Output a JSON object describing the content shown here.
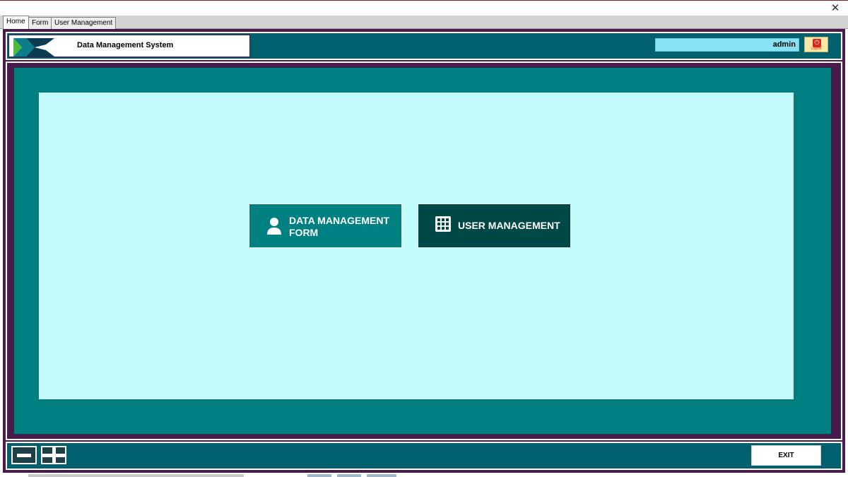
{
  "window": {
    "close_glyph": "✕"
  },
  "tabs": [
    {
      "label": "Home",
      "active": true
    },
    {
      "label": "Form",
      "active": false
    },
    {
      "label": "User Management",
      "active": false
    }
  ],
  "header": {
    "title": "Data Management System",
    "username": "admin",
    "logout_label": "Logout",
    "logo_icon": "brand-logo-icon"
  },
  "main": {
    "buttons": {
      "data_form_line1": "DATA MANAGEMENT",
      "data_form_line2": "FORM",
      "user_mgmt": "USER MANAGEMENT"
    },
    "icons": {
      "data_form": "person-icon",
      "user_mgmt": "grid-icon"
    }
  },
  "footer": {
    "exit_label": "EXIT"
  },
  "colors": {
    "frame": "#4a1a4f",
    "header_teal": "#00606e",
    "main_teal": "#007f80",
    "panel": "#c1fbfc",
    "dark_button": "#004747",
    "user_field": "#87e3f3"
  }
}
